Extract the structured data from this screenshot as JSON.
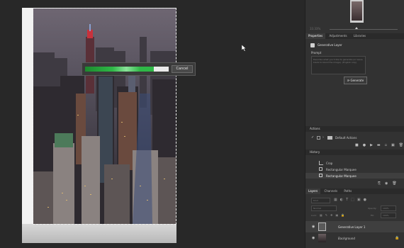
{
  "progress": {
    "fraction": 0.82,
    "cancel_label": "Cancel"
  },
  "navigator": {
    "zoom_label": "33.33%"
  },
  "properties": {
    "tabs": [
      "Properties",
      "Adjustments",
      "Libraries"
    ],
    "layer_type": "Generative Layer",
    "prompt_label": "Prompt",
    "prompt_placeholder": "Describe what you'd like to generate (or leave blank to blend the image). (English only)",
    "generate_label": "Generate"
  },
  "actions": {
    "title": "Actions",
    "set_name": "Default Actions"
  },
  "history": {
    "title": "History",
    "items": [
      "Crop",
      "Rectangular Marquee",
      "Rectangular Marquee"
    ]
  },
  "layers": {
    "tabs": [
      "Layers",
      "Channels",
      "Paths"
    ],
    "kind_label": "Kind",
    "blend_mode": "Normal",
    "opacity_label": "Opacity:",
    "opacity_value": "100%",
    "lock_label": "Lock:",
    "fill_label": "Fill:",
    "fill_value": "100%",
    "items": [
      "Generative Layer 1",
      "Background"
    ]
  },
  "colors": {
    "progress": "#2fb847",
    "panel": "#323232",
    "selected_row": "#3f3f3f"
  }
}
